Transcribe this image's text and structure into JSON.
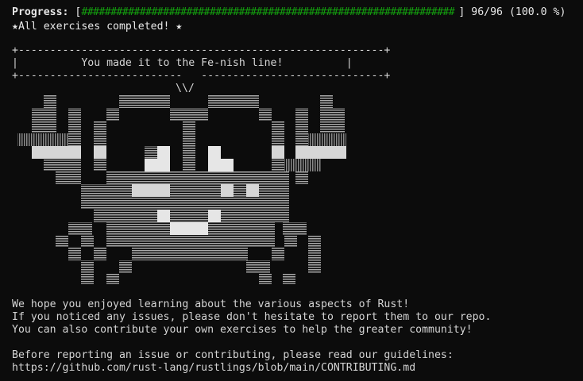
{
  "progress": {
    "label": "Progress:",
    "bar_open": "[",
    "bar_fill": "################################################################",
    "bar_close": "]",
    "count": "96/96",
    "percent": "(100.0 %)",
    "fraction": 1.0
  },
  "completed_message": "★All exercises completed! ★",
  "banner": {
    "top_border": "+----------------------------------------------------------+",
    "text": "|          You made it to the Fe-nish line!          |",
    "bottom_border": "+--------------------------   -----------------------------+",
    "antenna": "\\\\/"
  },
  "crab": {
    "body_color": "#bfbfbf",
    "highlight_color": "#e6e6e6"
  },
  "messages": [
    "We hope you enjoyed learning about the various aspects of Rust!",
    "If you noticed any issues, please don't hesitate to report them to our repo.",
    "You can also contribute your own exercises to help the greater community!"
  ],
  "guidelines": {
    "text": "Before reporting an issue or contributing, please read our guidelines:",
    "link": "https://github.com/rust-lang/rustlings/blob/main/CONTRIBUTING.md"
  }
}
